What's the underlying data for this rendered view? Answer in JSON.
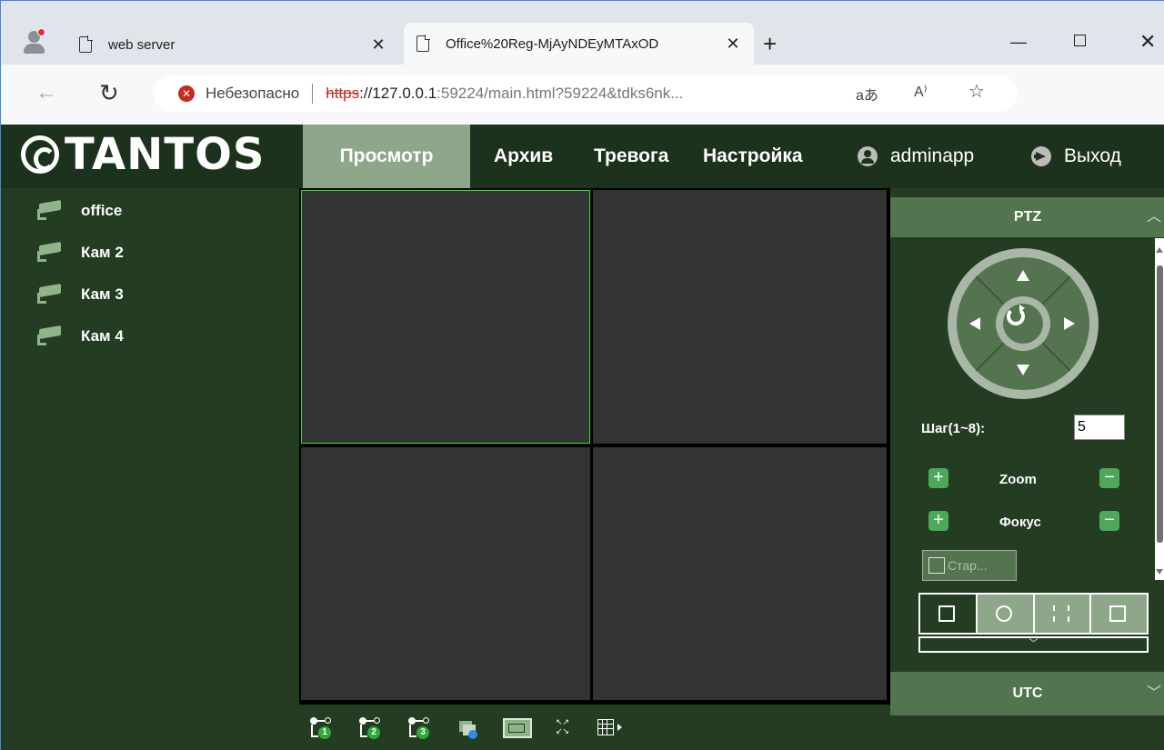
{
  "browser": {
    "tabs": [
      {
        "title": "web server"
      },
      {
        "title": "Office%20Reg-MjAyNDEyMTAxOD"
      }
    ],
    "address": {
      "security_label": "Небезопасно",
      "scheme": "https",
      "host": "://127.0.0.1",
      "rest": ":59224/main.html?59224&tdks6nk..."
    }
  },
  "app": {
    "logo": "TANTOS",
    "menu": {
      "view": "Просмотр",
      "archive": "Архив",
      "alarm": "Тревога",
      "settings": "Настройка",
      "user": "adminapp",
      "exit": "Выход"
    },
    "cameras": [
      {
        "name": "office"
      },
      {
        "name": "Кам 2"
      },
      {
        "name": "Кам 3"
      },
      {
        "name": "Кам 4"
      }
    ],
    "stream_buttons": [
      "1",
      "2",
      "3"
    ],
    "ptz": {
      "title": "PTZ",
      "step_label": "Шаг(1~8):",
      "step_value": "5",
      "zoom_label": "Zoom",
      "focus_label": "Фокус",
      "start_label": "Стар...",
      "utc_title": "UTC"
    }
  },
  "colors": {
    "header_bg": "#1d321c",
    "app_bg": "#233c22",
    "active_menu": "#8ea68a",
    "panel_head": "#52744f",
    "selected_tile_border": "#2ee62e"
  },
  "icons": [
    "profile-icon",
    "page-icon",
    "close-icon",
    "new-tab-icon",
    "back-icon",
    "reload-icon",
    "warning-icon",
    "read-aloud-icon",
    "favorite-icon",
    "user-icon",
    "exit-icon",
    "camera-icon",
    "stream-icon",
    "close-all-icon",
    "record-icon",
    "fullscreen-icon",
    "layout-grid-icon"
  ]
}
